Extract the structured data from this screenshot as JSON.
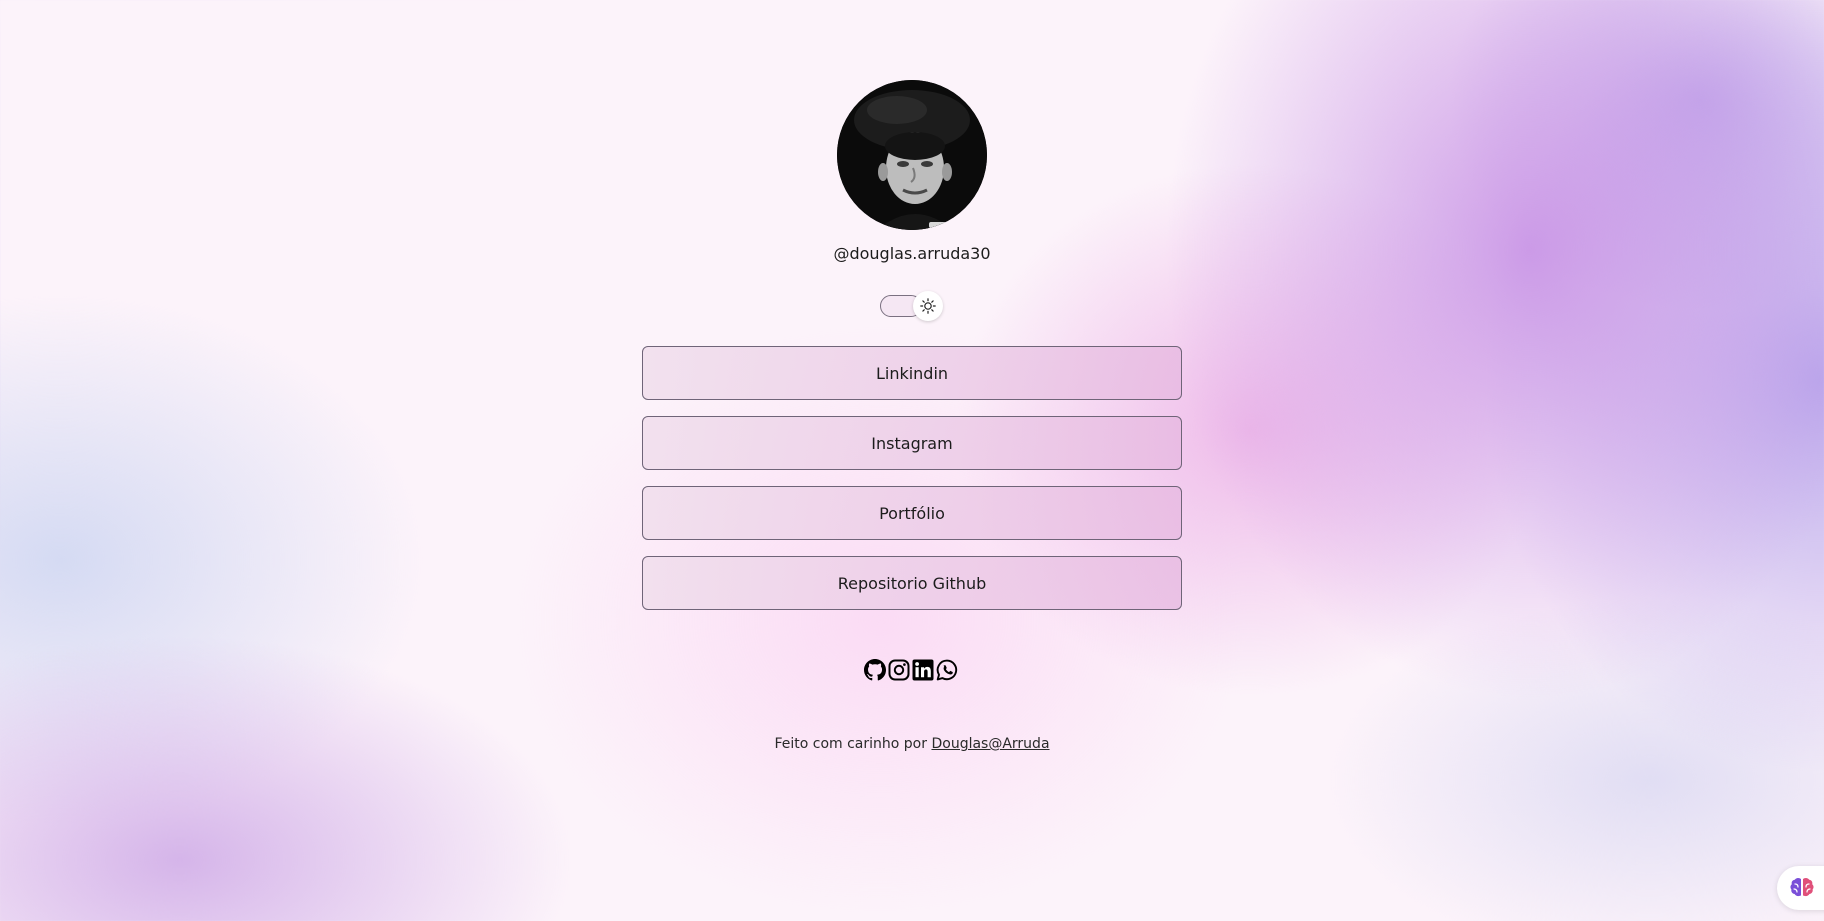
{
  "profile": {
    "username": "@douglas.arruda30",
    "avatar_icon": "profile-photo"
  },
  "theme_toggle": {
    "icon": "sun-icon",
    "mode": "light"
  },
  "links": [
    {
      "label": "Linkindin"
    },
    {
      "label": "Instagram"
    },
    {
      "label": "Portfólio"
    },
    {
      "label": "Repositorio Github"
    }
  ],
  "socials": [
    {
      "icon": "github-icon"
    },
    {
      "icon": "instagram-icon"
    },
    {
      "icon": "linkedin-icon"
    },
    {
      "icon": "whatsapp-icon"
    }
  ],
  "footer": {
    "text": "Feito com carinho por ",
    "link_text": "Douglas@Arruda"
  },
  "corner_widget": {
    "icon": "brain-icon"
  },
  "colors": {
    "accent_purple": "#c48ce4",
    "accent_pink": "#e8a2e2",
    "button_border": "#6f6478",
    "text": "#1c1c1c"
  }
}
